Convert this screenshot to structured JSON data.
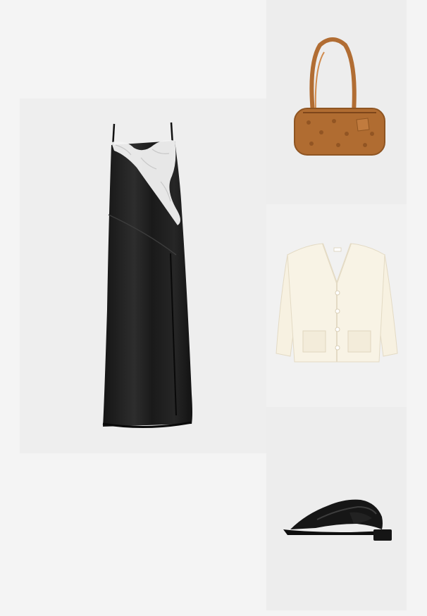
{
  "collage": {
    "items": [
      {
        "name": "dress",
        "icon": "black-lace-slip-dress-icon"
      },
      {
        "name": "bag",
        "icon": "cognac-monogram-shoulder-bag-icon"
      },
      {
        "name": "cardigan",
        "icon": "cream-knit-cardigan-icon"
      },
      {
        "name": "shoe",
        "icon": "black-square-toe-slide-icon"
      }
    ]
  }
}
